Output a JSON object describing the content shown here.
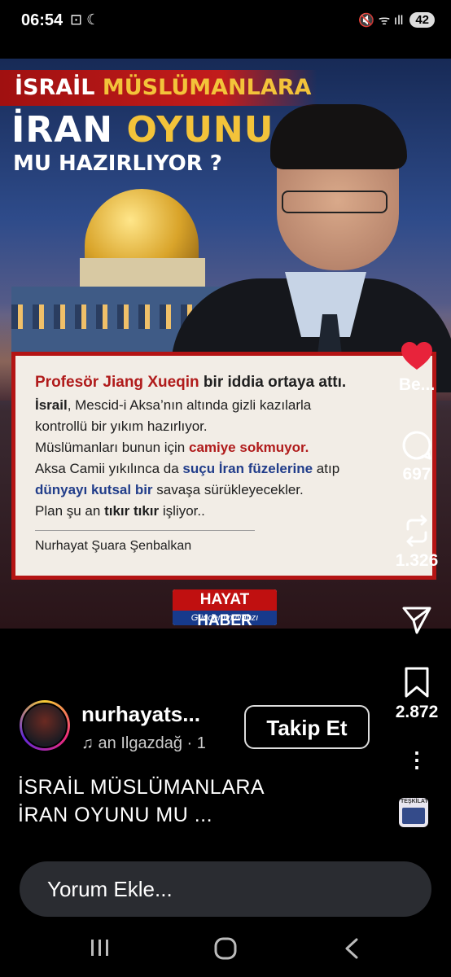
{
  "status": {
    "time": "06:54",
    "left_icons": "⊡ ☾",
    "right_icons": "🔇 ᯤ ıll",
    "battery": "42"
  },
  "post": {
    "headline": {
      "line1_white": "İSRAİL",
      "line1_gold": "MÜSLÜMANLARA",
      "line2_white": "İRAN",
      "line2_gold": "OYUNU",
      "line3": "MU HAZIRLIYOR ?"
    },
    "quote": {
      "l1_a": "Profesör Jiang Xueqin",
      "l1_b": " bir iddia ortaya attı.",
      "l2_a": "İsrail",
      "l2_b": ", Mescid-i Aksa’nın altında gizli kazılarla",
      "l3": "kontrollü bir yıkım hazırlıyor.",
      "l4_a": "Müslümanları bunun için ",
      "l4_b": "camiye sokmuyor.",
      "l5_a": "Aksa Camii yıkılınca da ",
      "l5_b": "suçu İran füzelerine",
      "l5_c": " atıp",
      "l6_a": "dünyayı kutsal bir",
      "l6_b": " savaşa sürükleyecekler.",
      "l7_a": "Plan şu an ",
      "l7_b": "tıkır tıkır",
      "l7_c": " işliyor..",
      "author": "Nurhayat Şuara Şenbalkan"
    },
    "logo": {
      "title": "HAYAT HABER",
      "subtitle": "Gündemin Nabzı"
    }
  },
  "actions": {
    "like_label": "Be...",
    "comment_count": "697",
    "repost_count": "1.326",
    "share_label": "",
    "save_count": "2.872"
  },
  "profile": {
    "username": "nurhayats...",
    "music": "♫ an Ilgazdağ · 1",
    "follow_label": "Takip Et"
  },
  "caption": {
    "line1": "İSRAİL MÜSLÜMANLARA",
    "line2": "İRAN OYUNU MU ..."
  },
  "thumb": {
    "text": "TEŞKİLAT"
  },
  "comment_box": {
    "placeholder": "Yorum Ekle..."
  },
  "colors": {
    "accent_red": "#b41414",
    "gold": "#f3c33a",
    "like_red": "#e8233b"
  }
}
